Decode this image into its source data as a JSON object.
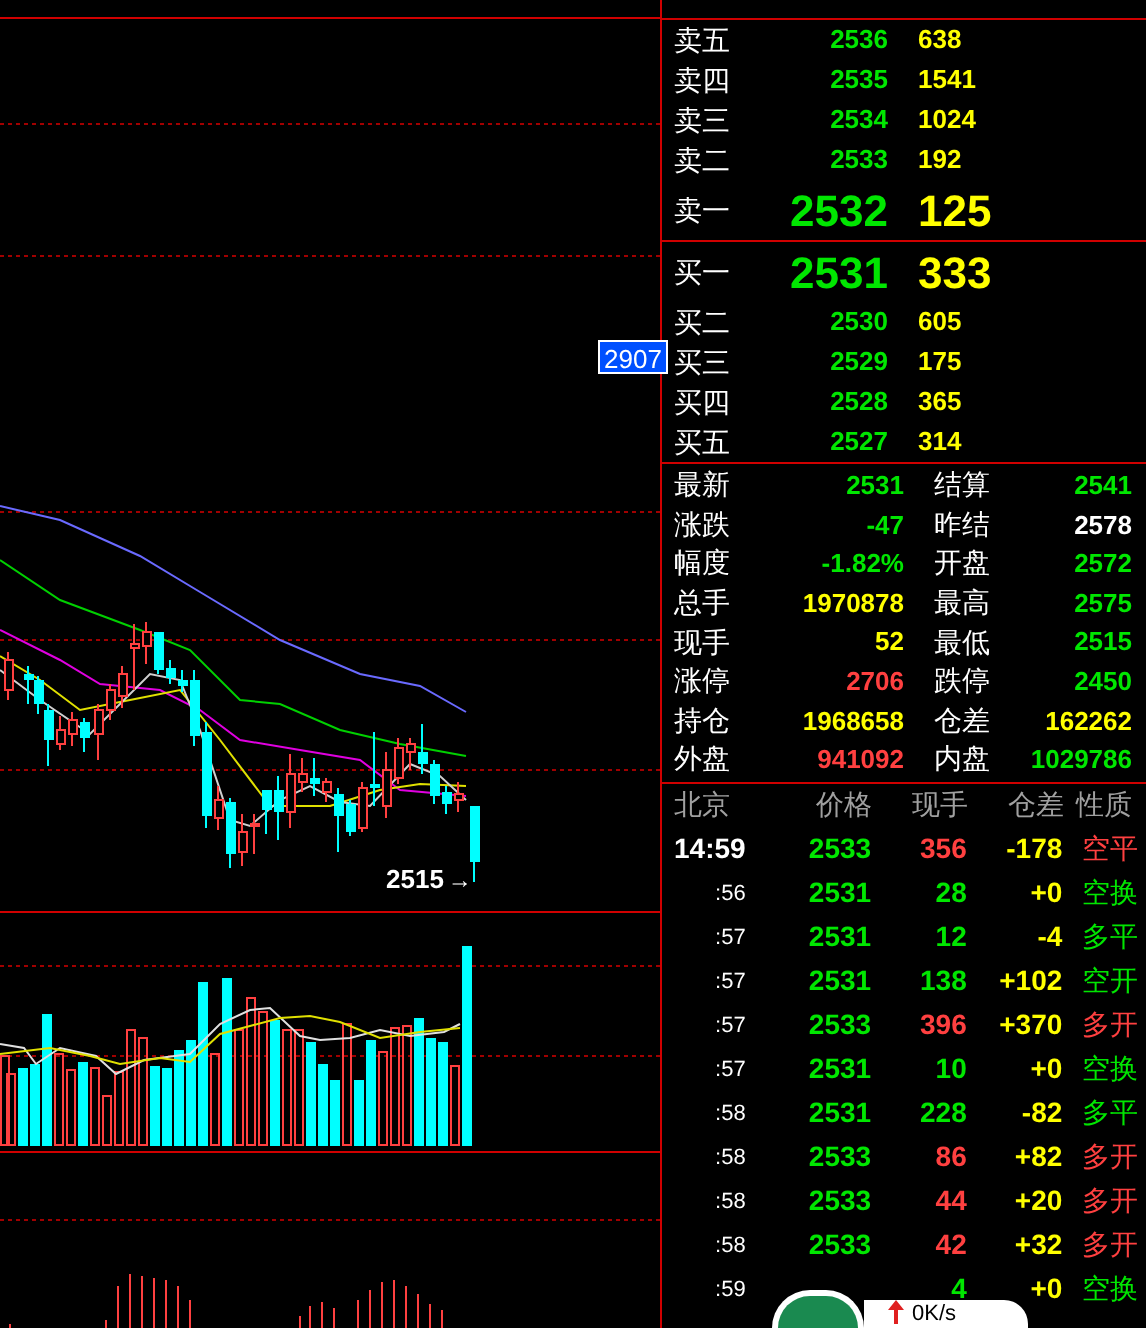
{
  "chart": {
    "price_tag": "2907",
    "low_label": "2515",
    "low_arrow": "→"
  },
  "order_book": {
    "asks": [
      {
        "label": "卖五",
        "price": "2536",
        "volume": "638",
        "kind": "level"
      },
      {
        "label": "卖四",
        "price": "2535",
        "volume": "1541",
        "kind": "level"
      },
      {
        "label": "卖三",
        "price": "2534",
        "volume": "1024",
        "kind": "level"
      },
      {
        "label": "卖二",
        "price": "2533",
        "volume": "192",
        "kind": "level"
      },
      {
        "label": "卖一",
        "price": "2532",
        "volume": "125",
        "kind": "best"
      }
    ],
    "bids": [
      {
        "label": "买一",
        "price": "2531",
        "volume": "333",
        "kind": "best"
      },
      {
        "label": "买二",
        "price": "2530",
        "volume": "605",
        "kind": "level"
      },
      {
        "label": "买三",
        "price": "2529",
        "volume": "175",
        "kind": "level"
      },
      {
        "label": "买四",
        "price": "2528",
        "volume": "365",
        "kind": "level"
      },
      {
        "label": "买五",
        "price": "2527",
        "volume": "314",
        "kind": "level"
      }
    ]
  },
  "stats": [
    {
      "label": "最新",
      "value": "2531",
      "color": "#00e600"
    },
    {
      "label": "结算",
      "value": "2541",
      "color": "#00e600"
    },
    {
      "label": "涨跌",
      "value": "-47",
      "color": "#00e600"
    },
    {
      "label": "昨结",
      "value": "2578",
      "color": "#ffffff"
    },
    {
      "label": "幅度",
      "value": "-1.82%",
      "color": "#00e600"
    },
    {
      "label": "开盘",
      "value": "2572",
      "color": "#00e600"
    },
    {
      "label": "总手",
      "value": "1970878",
      "color": "#ffff00"
    },
    {
      "label": "最高",
      "value": "2575",
      "color": "#00e600"
    },
    {
      "label": "现手",
      "value": "52",
      "color": "#ffff00"
    },
    {
      "label": "最低",
      "value": "2515",
      "color": "#00e600"
    },
    {
      "label": "涨停",
      "value": "2706",
      "color": "#ff4040"
    },
    {
      "label": "跌停",
      "value": "2450",
      "color": "#00e600"
    },
    {
      "label": "持仓",
      "value": "1968658",
      "color": "#ffff00"
    },
    {
      "label": "仓差",
      "value": "162262",
      "color": "#ffff00"
    },
    {
      "label": "外盘",
      "value": "941092",
      "color": "#ff4040"
    },
    {
      "label": "内盘",
      "value": "1029786",
      "color": "#00e600"
    }
  ],
  "trades": {
    "columns": [
      "北京",
      "价格",
      "现手",
      "仓差",
      "性质"
    ],
    "rows": [
      {
        "time": "14:59",
        "kind": "full",
        "price": "2533",
        "volume": "356",
        "oi_change": "-178",
        "nature": "空平",
        "color": "#ff4040"
      },
      {
        "time": ":56",
        "kind": "minute",
        "price": "2531",
        "volume": "28",
        "oi_change": "+0",
        "nature": "空换",
        "color": "#00e600"
      },
      {
        "time": ":57",
        "kind": "minute",
        "price": "2531",
        "volume": "12",
        "oi_change": "-4",
        "nature": "多平",
        "color": "#00e600"
      },
      {
        "time": ":57",
        "kind": "minute",
        "price": "2531",
        "volume": "138",
        "oi_change": "+102",
        "nature": "空开",
        "color": "#00e600"
      },
      {
        "time": ":57",
        "kind": "minute",
        "price": "2533",
        "volume": "396",
        "oi_change": "+370",
        "nature": "多开",
        "color": "#ff4040"
      },
      {
        "time": ":57",
        "kind": "minute",
        "price": "2531",
        "volume": "10",
        "oi_change": "+0",
        "nature": "空换",
        "color": "#00e600"
      },
      {
        "time": ":58",
        "kind": "minute",
        "price": "2531",
        "volume": "228",
        "oi_change": "-82",
        "nature": "多平",
        "color": "#00e600"
      },
      {
        "time": ":58",
        "kind": "minute",
        "price": "2533",
        "volume": "86",
        "oi_change": "+82",
        "nature": "多开",
        "color": "#ff4040"
      },
      {
        "time": ":58",
        "kind": "minute",
        "price": "2533",
        "volume": "44",
        "oi_change": "+20",
        "nature": "多开",
        "color": "#ff4040"
      },
      {
        "time": ":58",
        "kind": "minute",
        "price": "2533",
        "volume": "42",
        "oi_change": "+32",
        "nature": "多开",
        "color": "#ff4040"
      },
      {
        "time": ":59",
        "kind": "minute",
        "volume": "4",
        "oi_change": "+0",
        "nature": "空换",
        "color": "#00e600"
      }
    ]
  },
  "speed_widget": {
    "speed": "0K/s"
  }
}
